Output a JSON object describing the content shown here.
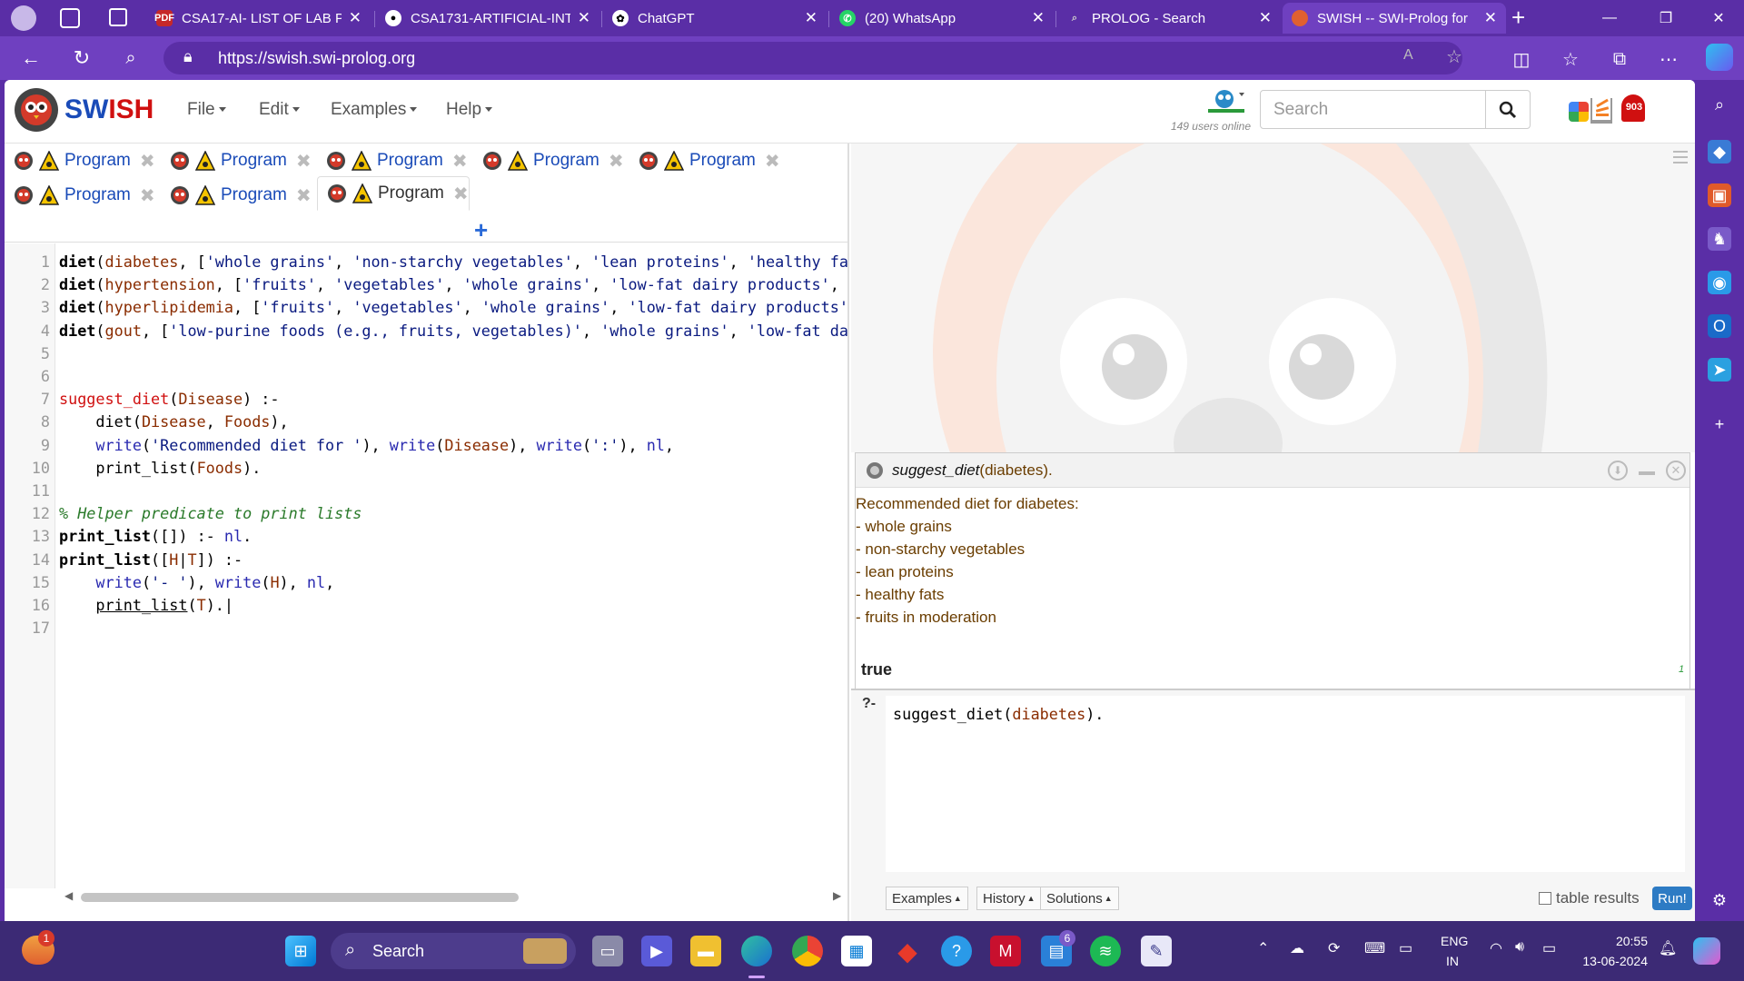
{
  "browser": {
    "tabs": [
      {
        "title": "CSA17-AI- LIST OF LAB P",
        "favicon": "pdf-icon"
      },
      {
        "title": "CSA1731-ARTIFICIAL-INT",
        "favicon": "github-icon"
      },
      {
        "title": "ChatGPT",
        "favicon": "chatgpt-icon"
      },
      {
        "title": "(20) WhatsApp",
        "favicon": "whatsapp-icon"
      },
      {
        "title": "PROLOG - Search",
        "favicon": "search-icon"
      },
      {
        "title": "SWISH -- SWI-Prolog for",
        "favicon": "swish-icon"
      }
    ],
    "url": "https://swish.swi-prolog.org"
  },
  "swish": {
    "brand_a": "SW",
    "brand_b": "ISH",
    "menus": [
      "File",
      "Edit",
      "Examples",
      "Help"
    ],
    "search_placeholder": "Search",
    "users_online": "149 users online",
    "notification_count": "903"
  },
  "program_tabs": {
    "row1": [
      "Program",
      "Program",
      "Program",
      "Program",
      "Program"
    ],
    "row2": [
      "Program",
      "Program",
      "Program"
    ]
  },
  "editor": {
    "lines": [
      {
        "n": "1",
        "html": "<span class='kw'>diet</span>(<span class='var'>diabetes</span>, [<span class='str'>'whole grains'</span>, <span class='str'>'non-starchy vegetables'</span>, <span class='str'>'lean proteins'</span>, <span class='str'>'healthy fats'</span>, "
      },
      {
        "n": "2",
        "html": "<span class='kw'>diet</span>(<span class='var'>hypertension</span>, [<span class='str'>'fruits'</span>, <span class='str'>'vegetables'</span>, <span class='str'>'whole grains'</span>, <span class='str'>'low-fat dairy products'</span>, <span class='str'>'lean</span>"
      },
      {
        "n": "3",
        "html": "<span class='kw'>diet</span>(<span class='var'>hyperlipidemia</span>, [<span class='str'>'fruits'</span>, <span class='str'>'vegetables'</span>, <span class='str'>'whole grains'</span>, <span class='str'>'low-fat dairy products'</span>, <span class='str'>'le</span>"
      },
      {
        "n": "4",
        "html": "<span class='kw'>diet</span>(<span class='var'>gout</span>, [<span class='str'>'low-purine foods (e.g., fruits, vegetables)'</span>, <span class='str'>'whole grains'</span>, <span class='str'>'low-fat dairy p</span>"
      },
      {
        "n": "5",
        "html": ""
      },
      {
        "n": "6",
        "html": ""
      },
      {
        "n": "7",
        "html": "<span class='fn'>suggest_diet</span>(<span class='var'>Disease</span>) :-"
      },
      {
        "n": "8",
        "html": "    diet(<span class='var'>Disease</span>, <span class='var'>Foods</span>),"
      },
      {
        "n": "9",
        "html": "    <span class='bi'>write</span>(<span class='str'>'Recommended diet for '</span>), <span class='bi'>write</span>(<span class='var'>Disease</span>), <span class='bi'>write</span>(<span class='str'>':'</span>), <span class='bi'>nl</span>,"
      },
      {
        "n": "10",
        "html": "    print_list(<span class='var'>Foods</span>)."
      },
      {
        "n": "11",
        "html": ""
      },
      {
        "n": "12",
        "html": "<span class='cm'>% Helper predicate to print lists</span>"
      },
      {
        "n": "13",
        "html": "<span class='kw'>print_list</span>([]) :- <span class='bi'>nl</span>."
      },
      {
        "n": "14",
        "html": "<span class='kw'>print_list</span>([<span class='var'>H</span>|<span class='var'>T</span>]) :-"
      },
      {
        "n": "15",
        "html": "    <span class='bi'>write</span>(<span class='str'>'- '</span>), <span class='bi'>write</span>(<span class='var'>H</span>), <span class='bi'>nl</span>,"
      },
      {
        "n": "16",
        "html": "    <u>print_list</u>(<span class='var'>T</span>).|"
      },
      {
        "n": "17",
        "html": ""
      }
    ]
  },
  "runner": {
    "query_pred": "suggest_diet",
    "query_arg": "(diabetes).",
    "output": [
      "Recommended diet for diabetes:",
      "- whole grains",
      "- non-starchy vegetables",
      "- lean proteins",
      "- healthy fats",
      "- fruits in moderation"
    ],
    "result": "true",
    "solution_count": "1"
  },
  "query": {
    "prompt": "?-",
    "pred": "suggest_diet",
    "arg": "diabetes",
    "buttons": [
      "Examples",
      "History",
      "Solutions"
    ],
    "table_results_label": "table results",
    "run_label": "Run!"
  },
  "taskbar": {
    "search_placeholder": "Search",
    "weather_badge": "1",
    "teams_badge": "6",
    "lang_top": "ENG",
    "lang_bottom": "IN",
    "time": "20:55",
    "date": "13-06-2024"
  }
}
